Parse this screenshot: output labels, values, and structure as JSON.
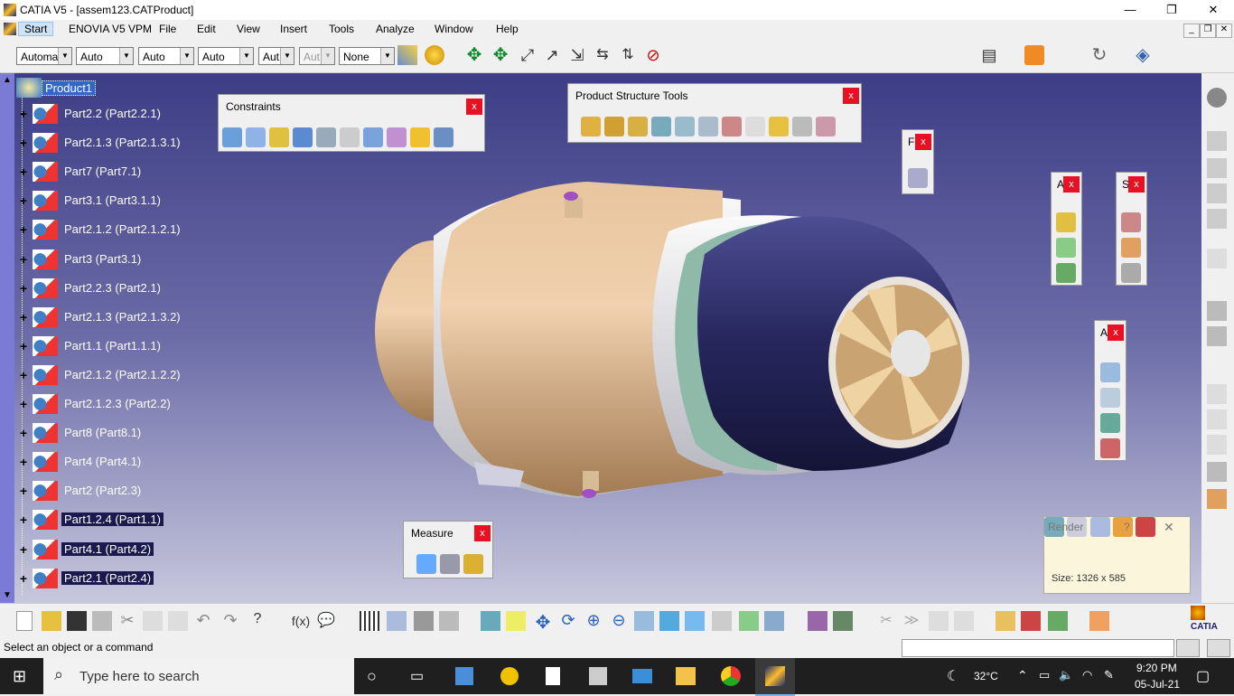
{
  "window": {
    "title": "CATIA V5 - [assem123.CATProduct]",
    "min": "—",
    "max": "❐",
    "close": "✕"
  },
  "menu": {
    "items": [
      "Start",
      "ENOVIA V5 VPM",
      "File",
      "Edit",
      "View",
      "Insert",
      "Tools",
      "Analyze",
      "Window",
      "Help"
    ]
  },
  "mdi": {
    "min": "_",
    "restore": "❐",
    "close": "✕"
  },
  "toolbar_combos": [
    {
      "value": "Automa",
      "disabled": false
    },
    {
      "value": "Auto",
      "disabled": false
    },
    {
      "value": "Auto",
      "disabled": false
    },
    {
      "value": "Auto",
      "disabled": false
    },
    {
      "value": "Aut",
      "disabled": false
    },
    {
      "value": "Aut",
      "disabled": true
    },
    {
      "value": "None",
      "disabled": false
    }
  ],
  "tree": {
    "root": "Product1",
    "items": [
      "Part2.2 (Part2.2.1)",
      "Part2.1.3 (Part2.1.3.1)",
      "Part7 (Part7.1)",
      "Part3.1 (Part3.1.1)",
      "Part2.1.2 (Part2.1.2.1)",
      "Part3 (Part3.1)",
      "Part2.2.3 (Part2.1)",
      "Part2.1.3 (Part2.1.3.2)",
      "Part1.1 (Part1.1.1)",
      "Part2.1.2 (Part2.1.2.2)",
      "Part2.1.2.3 (Part2.2)",
      "Part8 (Part8.1)",
      "Part4 (Part4.1)",
      "Part2 (Part2.3)",
      "Part1.2.4 (Part1.1)",
      "Part4.1 (Part4.2)",
      "Part2.1 (Part2.4)"
    ]
  },
  "panels": {
    "constraints": {
      "title": "Constraints",
      "close": "x"
    },
    "product_structure": {
      "title": "Product Structure Tools",
      "close": "x"
    },
    "f_panel": {
      "title": "F",
      "close": "x"
    },
    "a_panel": {
      "title": "A",
      "close": "x"
    },
    "s_panel": {
      "title": "S",
      "close": "x"
    },
    "a2_panel": {
      "title": "A",
      "close": "x"
    },
    "measure": {
      "title": "Measure",
      "close": "x"
    }
  },
  "render": {
    "title": "Render",
    "help": "?",
    "close": "✕",
    "size": "Size: 1326 x 585"
  },
  "brand": "CATIA",
  "status": {
    "text": "Select an object or a command"
  },
  "taskbar": {
    "search_placeholder": "Type here to search",
    "temperature": "32°C",
    "time": "9:20 PM",
    "date": "05-Jul-21"
  },
  "colors": {
    "viewport_top": "#3d3d86",
    "viewport_bottom": "#c7c7dd",
    "selection": "#3366cc",
    "close_red": "#e81123"
  }
}
